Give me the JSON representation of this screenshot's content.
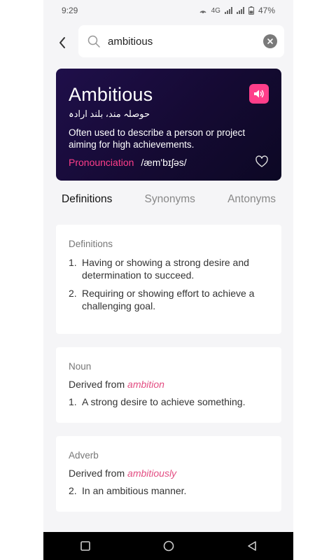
{
  "status": {
    "time": "9:29",
    "network": "4G",
    "battery": "47%"
  },
  "search": {
    "value": "ambitious",
    "placeholder": ""
  },
  "word_card": {
    "word": "Ambitious",
    "translation": "حوصلہ مند، بلند ارادہ",
    "description": "Often used to describe a person or project aiming for high achievements.",
    "pronunciation_label": "Pronounciation",
    "pronunciation_value": "/æm'bɪʃəs/"
  },
  "tabs": [
    {
      "label": "Definitions",
      "active": true
    },
    {
      "label": "Synonyms",
      "active": false
    },
    {
      "label": "Antonyms",
      "active": false
    }
  ],
  "definitions_section": {
    "title": "Definitions",
    "items": [
      {
        "num": "1.",
        "text": "Having or showing a strong desire and determination to succeed."
      },
      {
        "num": "2.",
        "text": "Requiring or showing effort to achieve a challenging goal."
      }
    ]
  },
  "noun_section": {
    "title": "Noun",
    "derived_prefix": "Derived from",
    "derived_word": "ambition",
    "items": [
      {
        "num": "1.",
        "text": "A strong desire to achieve something."
      }
    ]
  },
  "adverb_section": {
    "title": "Adverb",
    "derived_prefix": "Derived from",
    "derived_word": "ambitiously",
    "items": [
      {
        "num": "2.",
        "text": "In an ambitious manner."
      }
    ]
  },
  "colors": {
    "accent": "#ff3e8a",
    "card_bg": "#1f0f4a",
    "link": "#e34d82"
  },
  "icons": {
    "back": "chevron-left-icon",
    "search": "search-icon",
    "clear": "close-circle-icon",
    "speaker": "speaker-icon",
    "favorite": "heart-icon",
    "recents": "square-icon",
    "home": "circle-icon",
    "back_nav": "triangle-back-icon"
  }
}
